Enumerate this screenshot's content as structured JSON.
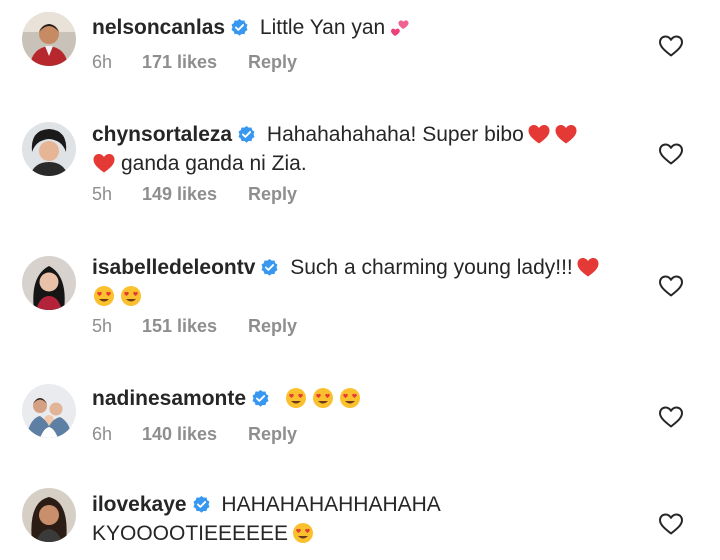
{
  "comments": [
    {
      "username": "nelsoncanlas",
      "text": "Little Yan yan",
      "emojis": [
        "two-hearts"
      ],
      "time": "6h",
      "likes": "171 likes",
      "reply": "Reply"
    },
    {
      "username": "chynsortaleza",
      "text": "Hahahahahaha! Super bibo",
      "emojis": [
        "red-heart",
        "red-heart"
      ],
      "text2": "ganda ganda ni Zia.",
      "emojis2_before": [
        "red-heart"
      ],
      "time": "5h",
      "likes": "149 likes",
      "reply": "Reply"
    },
    {
      "username": "isabelledeleontv",
      "text": "Such a charming young lady!!!",
      "emojis": [
        "red-heart"
      ],
      "emojis2_before": [
        "heart-eyes",
        "heart-eyes"
      ],
      "time": "5h",
      "likes": "151 likes",
      "reply": "Reply"
    },
    {
      "username": "nadinesamonte",
      "text": "",
      "emojis": [
        "heart-eyes",
        "heart-eyes",
        "heart-eyes"
      ],
      "time": "6h",
      "likes": "140 likes",
      "reply": "Reply"
    },
    {
      "username": "ilovekaye",
      "text": "HAHAHAHAHHAHAHA",
      "text2": "KYOOOOTIEEEEEE",
      "emojis2_after": [
        "heart-eyes"
      ],
      "time": "",
      "likes": "",
      "reply": ""
    }
  ],
  "colors": {
    "username": "#262626",
    "meta": "#8e8e8e",
    "verified": "#3897f0",
    "heart": "#ed3c3c",
    "heart_eyes_face": "#fbc02d"
  }
}
